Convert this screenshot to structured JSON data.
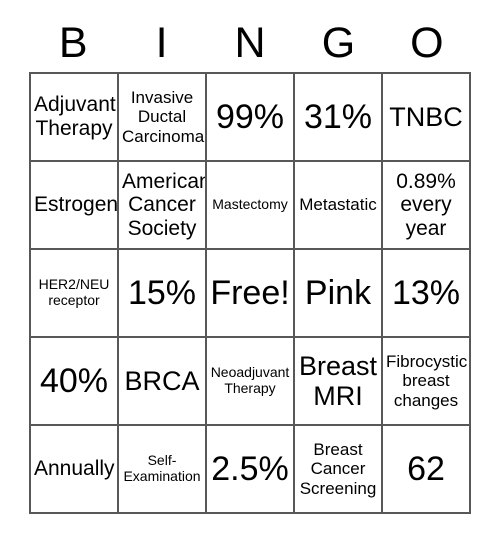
{
  "card": {
    "title": "BINGO",
    "header_letters": [
      "B",
      "I",
      "N",
      "G",
      "O"
    ],
    "colors": {
      "border": "#58585a",
      "cell_background": "#ffffff",
      "text": "#000000",
      "page_background": "#ffffff"
    },
    "rows": [
      [
        {
          "text": "Adjuvant Therapy",
          "size": "md"
        },
        {
          "text": "Invasive Ductal Carcinoma.",
          "size": "sm"
        },
        {
          "text": "99%",
          "size": "xl"
        },
        {
          "text": "31%",
          "size": "xl"
        },
        {
          "text": "TNBC",
          "size": "lg"
        }
      ],
      [
        {
          "text": "Estrogen",
          "size": "md"
        },
        {
          "text": "American Cancer Society",
          "size": "md"
        },
        {
          "text": "Mastectomy",
          "size": "xs"
        },
        {
          "text": "Metastatic",
          "size": "sm"
        },
        {
          "text": "0.89% every year",
          "size": "md"
        }
      ],
      [
        {
          "text": "HER2/NEU receptor",
          "size": "xs"
        },
        {
          "text": "15%",
          "size": "xl"
        },
        {
          "text": "Free!",
          "size": "xl"
        },
        {
          "text": "Pink",
          "size": "xl"
        },
        {
          "text": "13%",
          "size": "xl"
        }
      ],
      [
        {
          "text": "40%",
          "size": "xl"
        },
        {
          "text": "BRCA",
          "size": "lg"
        },
        {
          "text": "Neoadjuvant Therapy",
          "size": "xs"
        },
        {
          "text": "Breast MRI",
          "size": "lg"
        },
        {
          "text": "Fibrocystic breast changes",
          "size": "sm"
        }
      ],
      [
        {
          "text": "Annually",
          "size": "md"
        },
        {
          "text": "Self-Examination",
          "size": "xs"
        },
        {
          "text": "2.5%",
          "size": "xl"
        },
        {
          "text": "Breast Cancer Screening",
          "size": "sm"
        },
        {
          "text": "62",
          "size": "xl"
        }
      ]
    ],
    "free_space": {
      "row": 2,
      "column": 2,
      "label": "Free!"
    }
  }
}
